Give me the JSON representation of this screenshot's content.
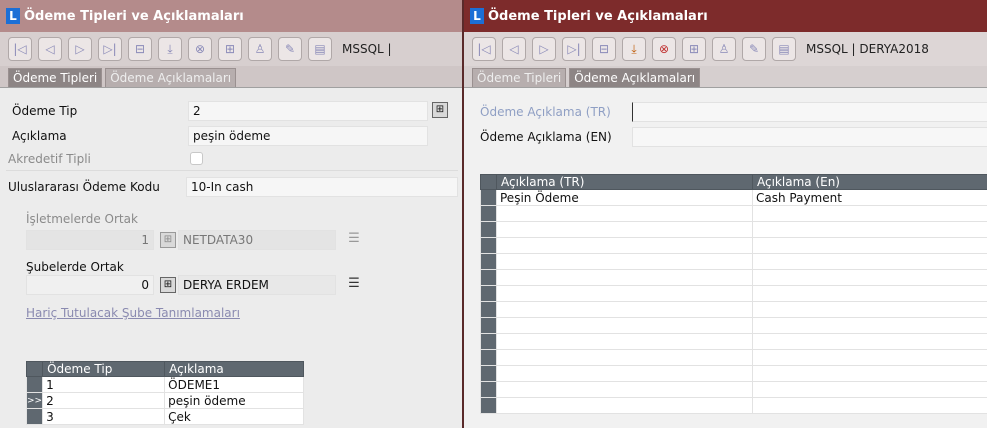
{
  "left": {
    "title": "Ödeme Tipleri ve Açıklamaları",
    "server": "MSSQL | ",
    "tabs": [
      "Ödeme Tipleri",
      "Ödeme Açıklamaları"
    ],
    "form": {
      "odeme_tip_label": "Ödeme Tip",
      "odeme_tip_value": "2",
      "aciklama_label": "Açıklama",
      "aciklama_value": "peşin ödeme",
      "akreditif_label": "Akredetif Tipli",
      "kod_label": "Uluslararası Ödeme Kodu",
      "kod_value": "10-In cash",
      "isletme_label": "İşletmelerde Ortak",
      "isletme_num": "1",
      "isletme_name": "NETDATA30",
      "sube_label": "Şubelerde Ortak",
      "sube_num": "0",
      "sube_name": "DERYA ERDEM",
      "link": "Hariç Tutulacak Şube Tanımlamaları"
    },
    "grid": {
      "headers": [
        "Ödeme Tip",
        "Açıklama"
      ],
      "rows": [
        {
          "marker": "",
          "tip": "1",
          "aciklama": "ÖDEME1"
        },
        {
          "marker": ">>",
          "tip": "2",
          "aciklama": "peşin ödeme"
        },
        {
          "marker": "",
          "tip": "3",
          "aciklama": "Çek"
        }
      ]
    }
  },
  "right": {
    "title": "Ödeme Tipleri ve Açıklamaları",
    "server": "MSSQL | DERYA2018",
    "tabs": [
      "Ödeme Tipleri",
      "Ödeme Açıklamaları"
    ],
    "form": {
      "tr_label": "Ödeme Açıklama (TR)",
      "tr_value": "",
      "en_label": "Ödeme Açıklama (EN)",
      "en_value": ""
    },
    "grid": {
      "headers": [
        "Açıklama (TR)",
        "Açıklama (En)"
      ],
      "rows": [
        {
          "tr": "Peşin Ödeme",
          "en": "Cash Payment"
        },
        {
          "tr": "",
          "en": ""
        },
        {
          "tr": "",
          "en": ""
        },
        {
          "tr": "",
          "en": ""
        },
        {
          "tr": "",
          "en": ""
        },
        {
          "tr": "",
          "en": ""
        },
        {
          "tr": "",
          "en": ""
        },
        {
          "tr": "",
          "en": ""
        },
        {
          "tr": "",
          "en": ""
        },
        {
          "tr": "",
          "en": ""
        },
        {
          "tr": "",
          "en": ""
        },
        {
          "tr": "",
          "en": ""
        },
        {
          "tr": "",
          "en": ""
        },
        {
          "tr": "",
          "en": ""
        }
      ]
    }
  },
  "toolbar_icons": [
    "first-icon",
    "prev-icon",
    "next-icon",
    "last-icon",
    "minus-icon",
    "download-icon",
    "close-circle-icon",
    "plus-icon",
    "user-icon",
    "edit-icon",
    "log-icon"
  ]
}
